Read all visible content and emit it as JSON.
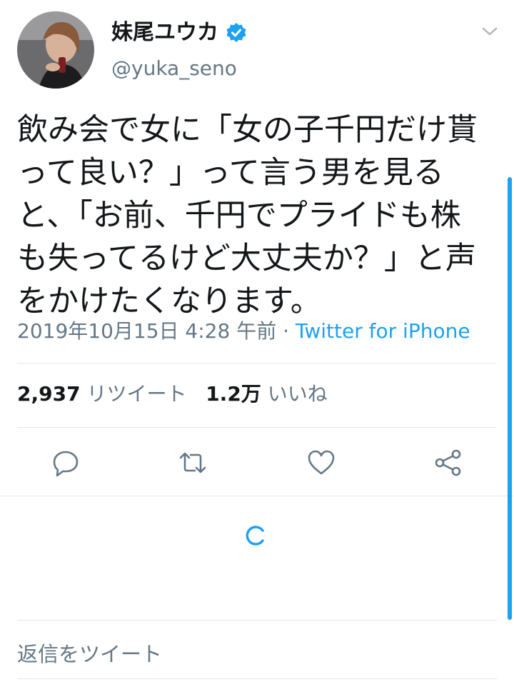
{
  "user": {
    "display_name": "妹尾ユウカ",
    "handle": "@yuka_seno",
    "verified": true
  },
  "tweet": {
    "text": "飲み会で女に「女の子千円だけ貰\nって良い？」って言う男を見る\nと、「お前、千円でプライドも株\nも失ってるけど大丈夫か？」と声\nをかけたくなります。",
    "timestamp": "2019年10月15日 4:28 午前",
    "separator": " · ",
    "source": "Twitter for iPhone"
  },
  "stats": {
    "retweets_count": "2,937",
    "retweets_label": "リツイート",
    "likes_count": "1.2万",
    "likes_label": "いいね"
  },
  "actions": [
    "reply-icon",
    "retweet-icon",
    "like-icon",
    "share-icon"
  ],
  "reply_prompt": "返信をツイート",
  "colors": {
    "accent": "#1da1f2",
    "text": "#14171a",
    "secondary": "#657786",
    "divider": "#e1e8ed"
  }
}
